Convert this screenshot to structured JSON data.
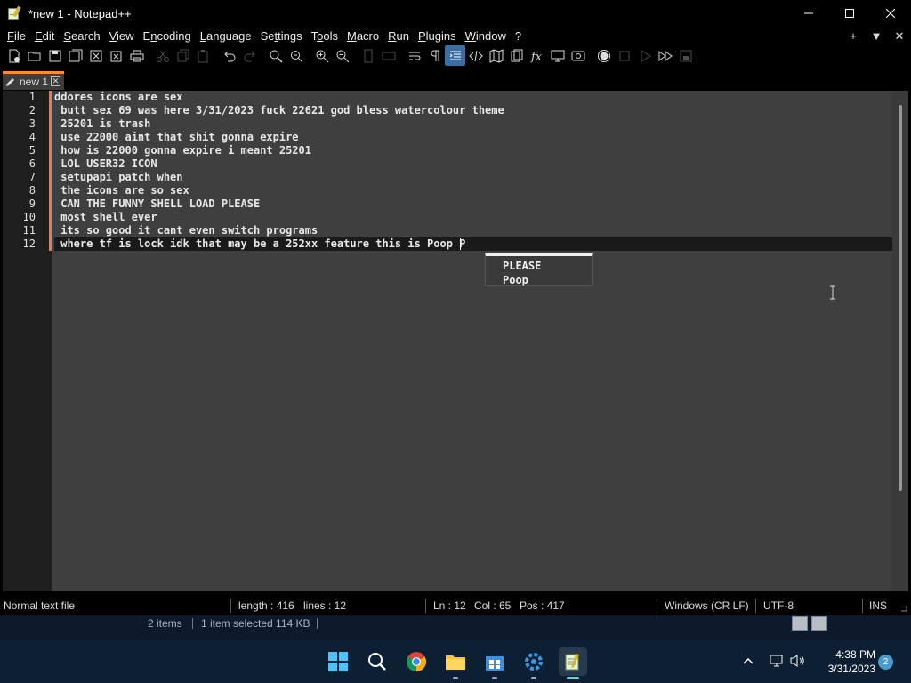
{
  "window": {
    "title": "*new 1 - Notepad++",
    "controls": {
      "minimize": "—",
      "maximize": "☐",
      "close": "✕"
    }
  },
  "menu": {
    "items": [
      {
        "label": "File",
        "accel": "F"
      },
      {
        "label": "Edit",
        "accel": "E"
      },
      {
        "label": "Search",
        "accel": "S"
      },
      {
        "label": "View",
        "accel": "V"
      },
      {
        "label": "Encoding",
        "accel": "n"
      },
      {
        "label": "Language",
        "accel": "L"
      },
      {
        "label": "Settings",
        "accel": "t"
      },
      {
        "label": "Tools",
        "accel": "o"
      },
      {
        "label": "Macro",
        "accel": "M"
      },
      {
        "label": "Run",
        "accel": "R"
      },
      {
        "label": "Plugins",
        "accel": "P"
      },
      {
        "label": "Window",
        "accel": "W"
      },
      {
        "label": "?",
        "accel": ""
      }
    ],
    "right": {
      "add": "+",
      "dropdown": "▼",
      "close": "✕"
    }
  },
  "tab": {
    "label": "new 1",
    "close": "✕"
  },
  "editor": {
    "line_numbers": [
      "1",
      "2",
      "3",
      "4",
      "5",
      "6",
      "7",
      "8",
      "9",
      "10",
      "11",
      "12"
    ],
    "lines": [
      "ddores icons are sex",
      " butt sex 69 was here 3/31/2023 fuck 22621 god bless watercolour theme",
      " 25201 is trash",
      " use 22000 aint that shit gonna expire",
      " how is 22000 gonna expire i meant 25201",
      " LOL USER32 ICON",
      " setupapi patch when",
      " the icons are so sex",
      " CAN THE FUNNY SHELL LOAD PLEASE",
      " most shell ever",
      " its so good it cant even switch programs",
      " where tf is lock idk that may be a 252xx feature this is Poop P"
    ],
    "autocomplete": [
      "PLEASE",
      "Poop"
    ]
  },
  "status": {
    "file_type": "Normal text file",
    "length": "length : 416",
    "lines": "lines : 12",
    "ln": "Ln : 12",
    "col": "Col : 65",
    "pos": "Pos : 417",
    "eol": "Windows (CR LF)",
    "encoding": "UTF-8",
    "mode": "INS"
  },
  "explorer": {
    "items": "2 items",
    "selected": "1 item selected  114 KB"
  },
  "taskbar": {
    "time": "4:38 PM",
    "date": "3/31/2023",
    "notifications": "2",
    "apps": [
      "start-icon",
      "search-icon",
      "chrome-icon",
      "file-explorer-icon",
      "store-icon",
      "settings-icon",
      "notepadpp-icon"
    ]
  },
  "colors": {
    "editor_bg": "#3f3f3f",
    "gutter_bg": "#1e1e1e",
    "accent": "#ff8c33",
    "active_toolbar": "#3a6ea5",
    "taskbar_bg": "#0d1f33"
  }
}
